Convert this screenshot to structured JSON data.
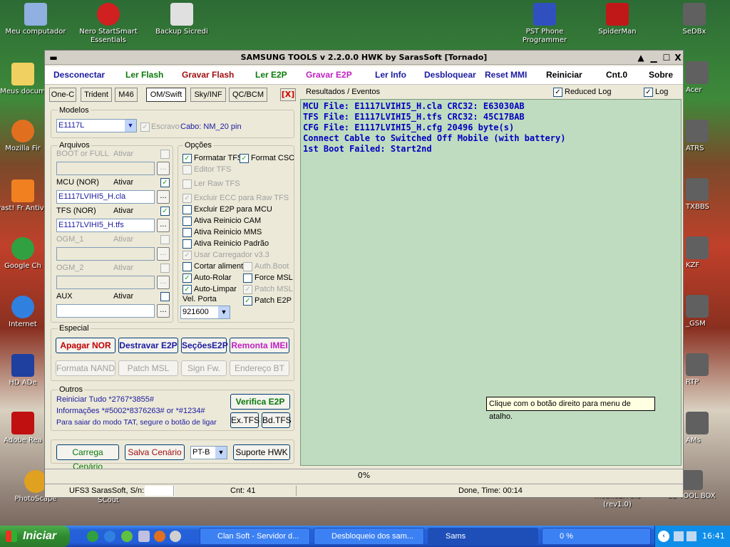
{
  "desktop_icons": [
    {
      "label": "Meu computador",
      "icon": "computer-icon"
    },
    {
      "label": "Nero StartSmart Essentials",
      "icon": "nero-icon"
    },
    {
      "label": "Backup Sicredi",
      "icon": "backup-icon"
    },
    {
      "label": "PST Phone Programmer",
      "icon": "pst-icon"
    },
    {
      "label": "SpiderMan",
      "icon": "spiderman-icon"
    },
    {
      "label": "SeDBx",
      "icon": "sedbx-icon"
    },
    {
      "label": "Meus docum",
      "icon": "documents-icon"
    },
    {
      "label": "Mozilla Fir",
      "icon": "firefox-icon"
    },
    {
      "label": "avast! Fr Antiviru",
      "icon": "avast-icon"
    },
    {
      "label": "Google Ch",
      "icon": "chrome-icon"
    },
    {
      "label": "Internet",
      "icon": "ie-icon"
    },
    {
      "label": "HD ADe",
      "icon": "hd-icon"
    },
    {
      "label": "Adobe Rea",
      "icon": "adobe-icon"
    },
    {
      "label": "PhotoScape",
      "icon": "photoscape-icon"
    },
    {
      "label": "SCout",
      "icon": "scout-icon"
    },
    {
      "label": "mobileEX 3.5 (rev1.0)",
      "icon": "mobileex-icon"
    },
    {
      "label": "SE TOOL BOX",
      "icon": "setoolbox-icon"
    },
    {
      "label": "Acer",
      "icon": "acer-icon"
    },
    {
      "label": "ATRS",
      "icon": "atrs-icon"
    },
    {
      "label": "TXBBS",
      "icon": "txbbs-icon"
    },
    {
      "label": "KZF",
      "icon": "kzf-icon"
    },
    {
      "label": "_GSM",
      "icon": "gsm-icon"
    },
    {
      "label": "RTP",
      "icon": "rtp-icon"
    },
    {
      "label": "AMs",
      "icon": "ams-icon"
    }
  ],
  "window": {
    "title": "SAMSUNG TOOLS v 2.2.0.0 HWK by SarasSoft  [Tornado]",
    "close": "X"
  },
  "menu": [
    {
      "label": "Desconectar",
      "color": "#1a1aa0"
    },
    {
      "label": "Ler Flash",
      "color": "#0a7a0a"
    },
    {
      "label": "Gravar Flash",
      "color": "#a01010"
    },
    {
      "label": "Ler E2P",
      "color": "#0a7a0a"
    },
    {
      "label": "Gravar E2P",
      "color": "#c020c0"
    },
    {
      "label": "Ler Info",
      "color": "#1a1aa0"
    },
    {
      "label": "Desbloquear",
      "color": "#1a1aa0"
    },
    {
      "label": "Reset MMI",
      "color": "#1a1aa0"
    },
    {
      "label": "Reiniciar",
      "color": "#000000"
    },
    {
      "label": "Cnt.0",
      "color": "#000000"
    },
    {
      "label": "Sobre",
      "color": "#000000"
    }
  ],
  "tabs": [
    "One-C",
    "Trident",
    "M46",
    "OM/Swift",
    "Sky/INF",
    "QC/BCM"
  ],
  "tab_close": "[X]",
  "modelos": {
    "label": "Modelos",
    "value": "E1117L",
    "escravo": "Escravo",
    "cabo": "Cabo: NM_20 pin"
  },
  "arquivos": {
    "label": "Arquivos",
    "rows": [
      {
        "name": "BOOT or FULL",
        "ativar": "Ativar",
        "value": "",
        "enabled": false,
        "checked": false
      },
      {
        "name": "MCU (NOR)",
        "ativar": "Ativar",
        "value": "E1117LVIHI5_H.cla",
        "enabled": true,
        "checked": true
      },
      {
        "name": "TFS (NOR)",
        "ativar": "Ativar",
        "value": "E1117LVIHI5_H.tfs",
        "enabled": true,
        "checked": true
      },
      {
        "name": "OGM_1",
        "ativar": "Ativar",
        "value": "",
        "enabled": false,
        "checked": false
      },
      {
        "name": "OGM_2",
        "ativar": "Ativar",
        "value": "",
        "enabled": false,
        "checked": false
      },
      {
        "name": "AUX",
        "ativar": "Ativar",
        "value": "",
        "enabled": true,
        "checked": false
      }
    ],
    "browse": "..."
  },
  "opcoes": {
    "label": "Opções",
    "items": [
      {
        "label": "Formatar TFS",
        "checked": true,
        "enabled": true
      },
      {
        "label": "Format CSC",
        "checked": true,
        "enabled": true
      },
      {
        "label": "Editor TFS",
        "checked": false,
        "enabled": false
      },
      {
        "label": "Ler Raw TFS",
        "checked": false,
        "enabled": false
      },
      {
        "label": "Excluir ECC para Raw TFS",
        "checked": true,
        "enabled": false
      },
      {
        "label": "Excluir E2P para MCU",
        "checked": false,
        "enabled": true
      },
      {
        "label": "Ativa Reinicio CAM",
        "checked": false,
        "enabled": true
      },
      {
        "label": "Ativa Reinicio MMS",
        "checked": false,
        "enabled": true
      },
      {
        "label": "Ativa Reinicio Padrão",
        "checked": false,
        "enabled": true
      },
      {
        "label": "Usar Carregador v3.3",
        "checked": true,
        "enabled": false
      },
      {
        "label": "Cortar alimenta",
        "checked": false,
        "enabled": true
      },
      {
        "label": "Auth.Boot",
        "checked": false,
        "enabled": false
      },
      {
        "label": "Auto-Rolar",
        "checked": true,
        "enabled": true
      },
      {
        "label": "Force MSL",
        "checked": false,
        "enabled": true
      },
      {
        "label": "Auto-Limpar",
        "checked": true,
        "enabled": true
      },
      {
        "label": "Patch MSL",
        "checked": true,
        "enabled": false
      },
      {
        "label": "Patch E2P",
        "checked": true,
        "enabled": true
      }
    ],
    "vel_label": "Vel. Porta",
    "vel_value": "921600"
  },
  "especial": {
    "label": "Especial",
    "buttons": [
      {
        "label": "Apagar NOR",
        "color": "#c00000",
        "enabled": true
      },
      {
        "label": "Destravar E2P",
        "color": "#1a1aa0",
        "enabled": true
      },
      {
        "label": "SeçõesE2P",
        "color": "#1a1aa0",
        "enabled": true
      },
      {
        "label": "Remonta IMEI",
        "color": "#c020c0",
        "enabled": true
      },
      {
        "label": "Formata NAND",
        "color": "#a0a0a0",
        "enabled": false
      },
      {
        "label": "Patch MSL",
        "color": "#a0a0a0",
        "enabled": false
      },
      {
        "label": "Sign Fw.",
        "color": "#a0a0a0",
        "enabled": false
      },
      {
        "label": "Endereço BT",
        "color": "#a0a0a0",
        "enabled": false
      }
    ]
  },
  "outros": {
    "label": "Outros",
    "lines": [
      "Reiniciar Tudo  *2767*3855#",
      "Informações  *#5002*8376263#  or *#1234#",
      "Para saiar do modo TAT, segure o botão de ligar"
    ],
    "verifica": "Verifica E2P",
    "ex_tfs": "Ex.TFS",
    "bd_tfs": "Bd.TFS"
  },
  "bottom_buttons": {
    "carrega": "Carrega Cenário",
    "salva": "Salva Cenário",
    "lang": "PT-B",
    "suporte": "Suporte HWK"
  },
  "resultados": {
    "label": "Resultados / Eventos",
    "reduced_log": "Reduced Log",
    "log": "Log",
    "lines": [
      "MCU File: E1117LVIHI5_H.cla CRC32: E63030AB",
      "TFS File: E1117LVIHI5_H.tfs CRC32: 45C17BAB",
      "CFG File: E1117LVIHI5_H.cfg 20496 byte(s)",
      "Connect Cable to Switched Off Mobile (with battery)",
      "1st Boot Failed: Start2nd"
    ]
  },
  "tooltip": "Clique com o botão direito para menu de atalho.",
  "progress": "0%",
  "status": {
    "serial": "UFS3 SarasSoft, S/n:",
    "cnt": "Cnt: 41",
    "done": "Done, Time: 00:14"
  },
  "taskbar": {
    "start": "Iniciar",
    "tasks": [
      "Clan Soft - Servidor d...",
      "Desbloqueio dos sam...",
      "Sams",
      "0 %"
    ],
    "clock": "16:41"
  }
}
